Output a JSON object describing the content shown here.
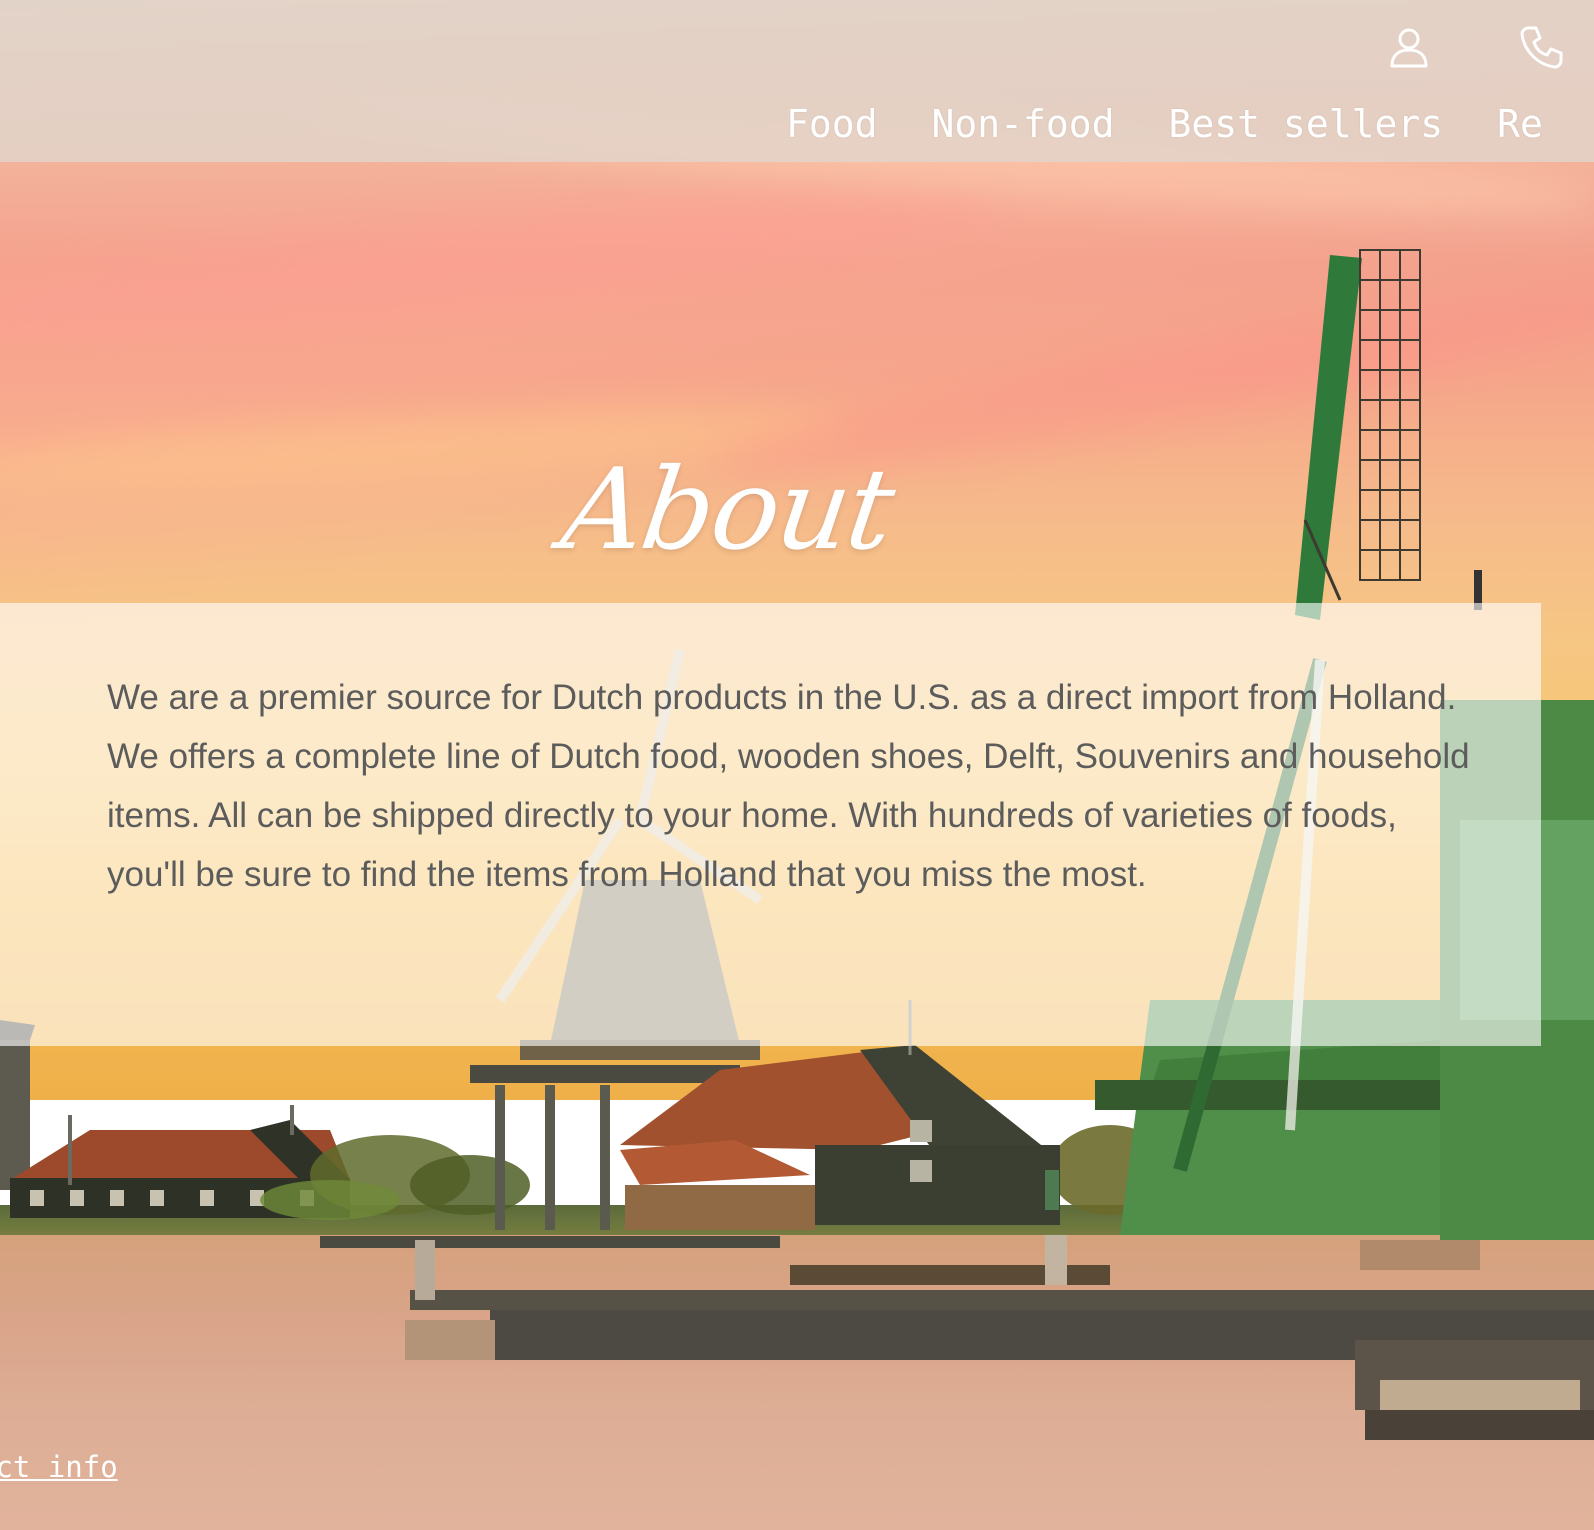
{
  "header": {
    "icons": [
      "user-icon",
      "phone-icon"
    ],
    "nav": {
      "food": "Food",
      "non_food": "Non-food",
      "best_sellers": "Best sellers",
      "partial_item": "Re"
    }
  },
  "about": {
    "title": "About",
    "body": "We are a premier source for Dutch products in the U.S. as a direct import from Holland. We offers a complete line of Dutch food, wooden shoes, Delft, Souvenirs and household items. All can be shipped directly to your home. With hundreds of varieties of foods, you'll be sure to find the items from Holland that you miss the most."
  },
  "footer": {
    "contact_link": "act info"
  },
  "colors": {
    "nav_text": "#ffffff",
    "header_bg": "#e0d6cd",
    "panel_bg": "#ffffff",
    "body_text": "#5c5c5c"
  }
}
